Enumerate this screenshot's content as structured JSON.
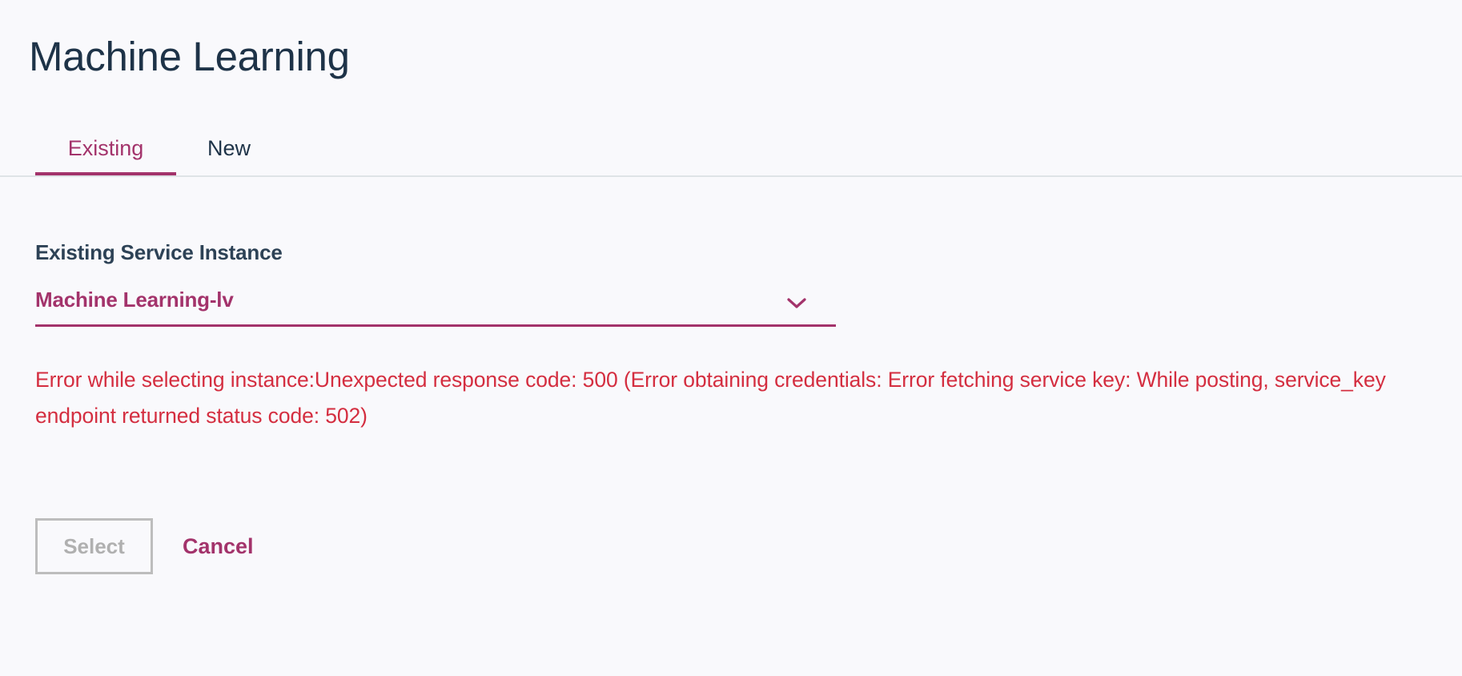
{
  "page": {
    "title": "Machine Learning"
  },
  "tabs": [
    {
      "label": "Existing",
      "active": true
    },
    {
      "label": "New",
      "active": false
    }
  ],
  "form": {
    "field_label": "Existing Service Instance",
    "selected_value": "Machine Learning-lv",
    "dropdown_icon": "chevron-down-icon",
    "error_message": "Error while selecting instance:Unexpected response code: 500 (Error obtaining credentials: Error fetching service key: While posting, service_key endpoint returned status code: 502)"
  },
  "actions": {
    "select_label": "Select",
    "select_disabled": true,
    "cancel_label": "Cancel"
  },
  "colors": {
    "accent": "#a3336b",
    "error": "#d42e40",
    "title": "#1e3348",
    "background": "#f9f9fc",
    "disabled": "#bdbdbd"
  }
}
